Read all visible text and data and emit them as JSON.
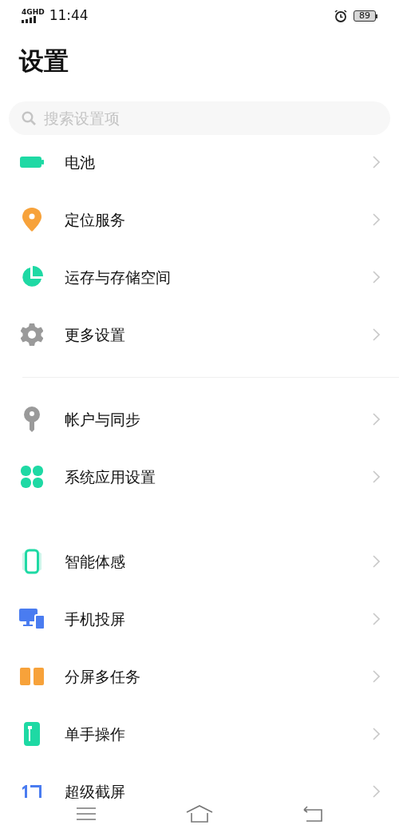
{
  "status_bar": {
    "network": "4GHD",
    "time": "11:44",
    "battery": "89"
  },
  "title": "设置",
  "search": {
    "placeholder": "搜索设置项"
  },
  "sections": [
    {
      "divider": true,
      "items": [
        {
          "label": "电池",
          "kind": "battery",
          "color": "#1ed9a4"
        },
        {
          "label": "定位服务",
          "kind": "location",
          "color": "#f7a23a"
        },
        {
          "label": "运存与存储空间",
          "kind": "storage",
          "color": "#1ed9a4"
        },
        {
          "label": "更多设置",
          "kind": "gear",
          "color": "#9a9a9a"
        }
      ]
    },
    {
      "divider": false,
      "items": [
        {
          "label": "帐户与同步",
          "kind": "key",
          "color": "#9a9a9a"
        },
        {
          "label": "系统应用设置",
          "kind": "apps",
          "color": "#1ed9a4"
        }
      ]
    },
    {
      "items": [
        {
          "label": "智能体感",
          "kind": "phone",
          "color": "#1ed9a4"
        },
        {
          "label": "手机投屏",
          "kind": "cast",
          "color": "#4a7cf0"
        },
        {
          "label": "分屏多任务",
          "kind": "split",
          "color": "#f7a23a"
        },
        {
          "label": "单手操作",
          "kind": "onehand",
          "color": "#1ed9a4"
        },
        {
          "label": "超级截屏",
          "kind": "screenshot",
          "color": "#4a7cf0"
        }
      ]
    }
  ]
}
